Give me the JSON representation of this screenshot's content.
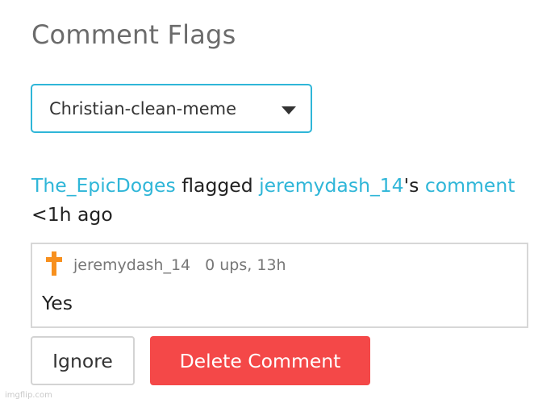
{
  "page": {
    "title": "Comment Flags"
  },
  "filter": {
    "selected": "Christian-clean-meme"
  },
  "flag": {
    "flagger": "The_EpicDoges",
    "action": " flagged ",
    "target_user": "jeremydash_14",
    "possessive": "'s ",
    "item_link": "comment",
    "time": " <1h ago"
  },
  "comment": {
    "icon": "cross-icon",
    "author": "jeremydash_14",
    "stats": "0 ups, 13h",
    "text": "Yes"
  },
  "actions": {
    "ignore_label": "Ignore",
    "delete_label": "Delete Comment"
  },
  "watermark": "imgflip.com",
  "colors": {
    "accent": "#2fb6d8",
    "danger": "#f44848",
    "cross": "#f7901e"
  }
}
